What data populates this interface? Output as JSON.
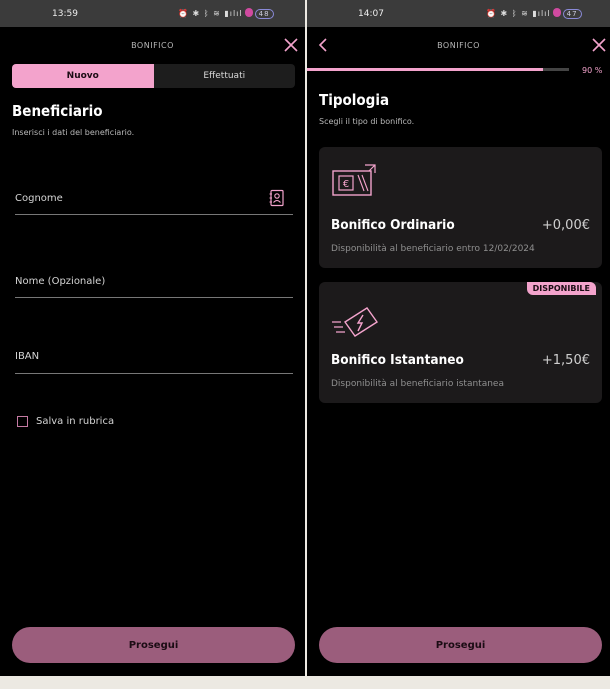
{
  "left_screen": {
    "status_time": "13:59",
    "battery": "48",
    "header_title": "BONIFICO",
    "tabs": [
      {
        "label": "Nuovo",
        "active": true
      },
      {
        "label": "Effettuati",
        "active": false
      }
    ],
    "section_title": "Beneficiario",
    "section_subtitle": "Inserisci i dati del beneficiario.",
    "fields": [
      {
        "label": "Cognome",
        "value": ""
      },
      {
        "label": "Nome (Opzionale)",
        "value": ""
      },
      {
        "label": "IBAN",
        "value": ""
      }
    ],
    "checkbox_label": "Salva in rubrica",
    "checkbox_checked": false,
    "cta_label": "Prosegui"
  },
  "right_screen": {
    "status_time": "14:07",
    "battery": "47",
    "header_title": "BONIFICO",
    "progress_percent": 90,
    "progress_label": "90 %",
    "section_title": "Tipologia",
    "section_subtitle": "Scegli il tipo di bonifico.",
    "options": [
      {
        "icon": "euro-banknote-icon",
        "title": "Bonifico Ordinario",
        "price": "+0,00€",
        "description": "Disponibilità al beneficiario entro 12/02/2024",
        "badge": ""
      },
      {
        "icon": "instant-banknote-icon",
        "title": "Bonifico Istantaneo",
        "price": "+1,50€",
        "description": "Disponibilità al beneficiario istantanea",
        "badge": "DISPONIBILE"
      }
    ],
    "cta_label": "Prosegui"
  },
  "colors": {
    "accent_pink": "#f3a3cc",
    "button_mauve": "#9b5d7c",
    "background": "#000000",
    "card": "#1c1a1b"
  }
}
